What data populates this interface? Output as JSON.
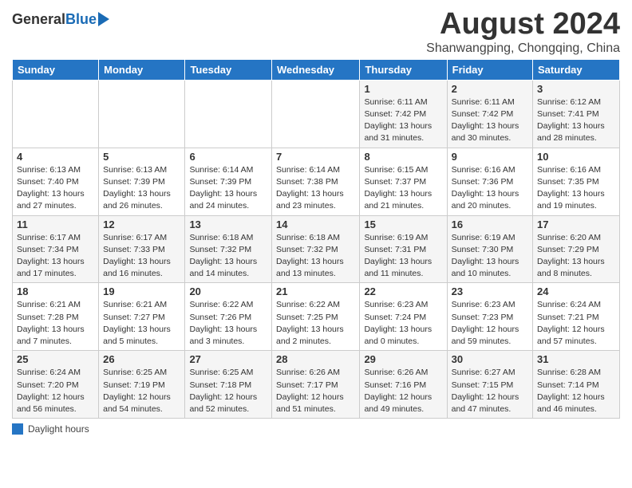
{
  "header": {
    "logo_general": "General",
    "logo_blue": "Blue",
    "month_title": "August 2024",
    "subtitle": "Shanwangping, Chongqing, China"
  },
  "days_of_week": [
    "Sunday",
    "Monday",
    "Tuesday",
    "Wednesday",
    "Thursday",
    "Friday",
    "Saturday"
  ],
  "weeks": [
    [
      {
        "day": "",
        "info": ""
      },
      {
        "day": "",
        "info": ""
      },
      {
        "day": "",
        "info": ""
      },
      {
        "day": "",
        "info": ""
      },
      {
        "day": "1",
        "info": "Sunrise: 6:11 AM\nSunset: 7:42 PM\nDaylight: 13 hours and 31 minutes."
      },
      {
        "day": "2",
        "info": "Sunrise: 6:11 AM\nSunset: 7:42 PM\nDaylight: 13 hours and 30 minutes."
      },
      {
        "day": "3",
        "info": "Sunrise: 6:12 AM\nSunset: 7:41 PM\nDaylight: 13 hours and 28 minutes."
      }
    ],
    [
      {
        "day": "4",
        "info": "Sunrise: 6:13 AM\nSunset: 7:40 PM\nDaylight: 13 hours and 27 minutes."
      },
      {
        "day": "5",
        "info": "Sunrise: 6:13 AM\nSunset: 7:39 PM\nDaylight: 13 hours and 26 minutes."
      },
      {
        "day": "6",
        "info": "Sunrise: 6:14 AM\nSunset: 7:39 PM\nDaylight: 13 hours and 24 minutes."
      },
      {
        "day": "7",
        "info": "Sunrise: 6:14 AM\nSunset: 7:38 PM\nDaylight: 13 hours and 23 minutes."
      },
      {
        "day": "8",
        "info": "Sunrise: 6:15 AM\nSunset: 7:37 PM\nDaylight: 13 hours and 21 minutes."
      },
      {
        "day": "9",
        "info": "Sunrise: 6:16 AM\nSunset: 7:36 PM\nDaylight: 13 hours and 20 minutes."
      },
      {
        "day": "10",
        "info": "Sunrise: 6:16 AM\nSunset: 7:35 PM\nDaylight: 13 hours and 19 minutes."
      }
    ],
    [
      {
        "day": "11",
        "info": "Sunrise: 6:17 AM\nSunset: 7:34 PM\nDaylight: 13 hours and 17 minutes."
      },
      {
        "day": "12",
        "info": "Sunrise: 6:17 AM\nSunset: 7:33 PM\nDaylight: 13 hours and 16 minutes."
      },
      {
        "day": "13",
        "info": "Sunrise: 6:18 AM\nSunset: 7:32 PM\nDaylight: 13 hours and 14 minutes."
      },
      {
        "day": "14",
        "info": "Sunrise: 6:18 AM\nSunset: 7:32 PM\nDaylight: 13 hours and 13 minutes."
      },
      {
        "day": "15",
        "info": "Sunrise: 6:19 AM\nSunset: 7:31 PM\nDaylight: 13 hours and 11 minutes."
      },
      {
        "day": "16",
        "info": "Sunrise: 6:19 AM\nSunset: 7:30 PM\nDaylight: 13 hours and 10 minutes."
      },
      {
        "day": "17",
        "info": "Sunrise: 6:20 AM\nSunset: 7:29 PM\nDaylight: 13 hours and 8 minutes."
      }
    ],
    [
      {
        "day": "18",
        "info": "Sunrise: 6:21 AM\nSunset: 7:28 PM\nDaylight: 13 hours and 7 minutes."
      },
      {
        "day": "19",
        "info": "Sunrise: 6:21 AM\nSunset: 7:27 PM\nDaylight: 13 hours and 5 minutes."
      },
      {
        "day": "20",
        "info": "Sunrise: 6:22 AM\nSunset: 7:26 PM\nDaylight: 13 hours and 3 minutes."
      },
      {
        "day": "21",
        "info": "Sunrise: 6:22 AM\nSunset: 7:25 PM\nDaylight: 13 hours and 2 minutes."
      },
      {
        "day": "22",
        "info": "Sunrise: 6:23 AM\nSunset: 7:24 PM\nDaylight: 13 hours and 0 minutes."
      },
      {
        "day": "23",
        "info": "Sunrise: 6:23 AM\nSunset: 7:23 PM\nDaylight: 12 hours and 59 minutes."
      },
      {
        "day": "24",
        "info": "Sunrise: 6:24 AM\nSunset: 7:21 PM\nDaylight: 12 hours and 57 minutes."
      }
    ],
    [
      {
        "day": "25",
        "info": "Sunrise: 6:24 AM\nSunset: 7:20 PM\nDaylight: 12 hours and 56 minutes."
      },
      {
        "day": "26",
        "info": "Sunrise: 6:25 AM\nSunset: 7:19 PM\nDaylight: 12 hours and 54 minutes."
      },
      {
        "day": "27",
        "info": "Sunrise: 6:25 AM\nSunset: 7:18 PM\nDaylight: 12 hours and 52 minutes."
      },
      {
        "day": "28",
        "info": "Sunrise: 6:26 AM\nSunset: 7:17 PM\nDaylight: 12 hours and 51 minutes."
      },
      {
        "day": "29",
        "info": "Sunrise: 6:26 AM\nSunset: 7:16 PM\nDaylight: 12 hours and 49 minutes."
      },
      {
        "day": "30",
        "info": "Sunrise: 6:27 AM\nSunset: 7:15 PM\nDaylight: 12 hours and 47 minutes."
      },
      {
        "day": "31",
        "info": "Sunrise: 6:28 AM\nSunset: 7:14 PM\nDaylight: 12 hours and 46 minutes."
      }
    ]
  ],
  "legend": {
    "label": "Daylight hours"
  }
}
